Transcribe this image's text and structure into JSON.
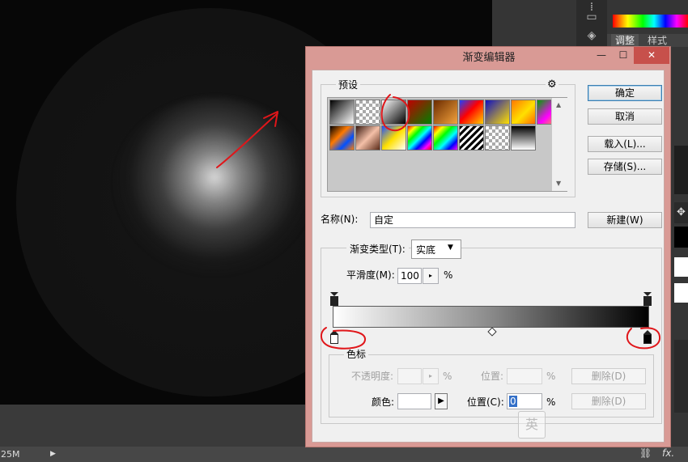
{
  "status": {
    "zoom": "25M",
    "fx_label": "fx."
  },
  "right_panel": {
    "tabs": [
      "调整",
      "样式"
    ]
  },
  "dialog": {
    "title": "渐变编辑器",
    "window_controls": {
      "minimize": "—",
      "maximize": "☐",
      "close": "✕"
    },
    "presets_label": "预设",
    "settings_icon": "⚙",
    "buttons": {
      "ok": "确定",
      "cancel": "取消",
      "load": "载入(L)...",
      "save": "存储(S)...",
      "new": "新建(W)"
    },
    "name_label": "名称(N):",
    "name_value": "自定",
    "gradient_type_label": "渐变类型(T):",
    "gradient_type_value": "实底",
    "smoothness_label": "平滑度(M):",
    "smoothness_value": "100",
    "percent": "%",
    "color_stops_label": "色标",
    "opacity_label": "不透明度:",
    "position_label": "位置:",
    "delete_label": "删除(D)",
    "color_label": "颜色:",
    "position_c_label": "位置(C):",
    "position_c_value": "0",
    "ime_glyph": "英"
  },
  "presets": [
    "linear-gradient(135deg,#000 0%,#fff 100%)",
    "repeating-conic-gradient(#aaa 0% 25%, #fff 0% 50%) 0 0/8px 8px",
    "linear-gradient(135deg,#fff 0%,#000 100%)",
    "linear-gradient(135deg,#c00000 0%,#008000 100%)",
    "linear-gradient(135deg,#6b2c00 0%,#f3a23c 100%)",
    "linear-gradient(135deg,#2040ff 0%,#ff0000 45%,#ffd000 100%)",
    "linear-gradient(135deg,#1010c0 0%,#ffe000 100%)",
    "linear-gradient(135deg,#ff7700 0%,#ffe000 55%,#ff6a00 100%)",
    "linear-gradient(135deg,#00a000 0%,#ff00ff 55%,#ffd000 100%)",
    "linear-gradient(135deg,#000 0%,#ff7a00 40%,#0050ff 70%,#ff7a00 100%)",
    "linear-gradient(135deg,#3a1a10 0%,#f4c0a8 50%,#5a2a18 100%)",
    "linear-gradient(135deg,#2050ff 0%,#ffe000 50%,#fff 100%)",
    "linear-gradient(135deg,#f00,#ff0,#0f0,#0ff,#00f,#f0f,#f00)",
    "linear-gradient(135deg,#f00,#ff0,#0f0,#0ff,#00f,#f0f)",
    "repeating-linear-gradient(135deg,#000 0 3px,#fff 3px 6px)",
    "repeating-conic-gradient(#aaa 0% 25%, #fff 0% 50%) 0 0/8px 8px",
    "linear-gradient(180deg,#000 0%,#fff 100%)"
  ],
  "colors": {
    "dialog_frame": "#d99a95",
    "close_button": "#c7504b",
    "annotation_red": "#e0161a",
    "canvas": "#070707"
  }
}
